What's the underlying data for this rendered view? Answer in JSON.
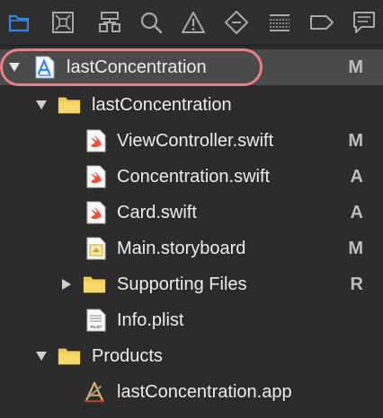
{
  "toolbar": {
    "buttons": [
      {
        "name": "project-navigator-button",
        "icon": "folder-icon",
        "active": true
      },
      {
        "name": "source-control-navigator-button",
        "icon": "source-control-icon"
      },
      {
        "name": "symbol-navigator-button",
        "icon": "hierarchy-icon"
      },
      {
        "name": "find-navigator-button",
        "icon": "search-icon"
      },
      {
        "name": "issue-navigator-button",
        "icon": "warning-icon"
      },
      {
        "name": "test-navigator-button",
        "icon": "diamond-icon"
      },
      {
        "name": "debug-navigator-button",
        "icon": "list-icon"
      },
      {
        "name": "breakpoint-navigator-button",
        "icon": "tag-icon"
      },
      {
        "name": "report-navigator-button",
        "icon": "message-icon"
      }
    ]
  },
  "tree": {
    "root": {
      "label": "lastConcentration",
      "status": "M",
      "icon": "xcode-project-icon",
      "expanded": true
    },
    "group": {
      "label": "lastConcentration",
      "icon": "folder-icon",
      "expanded": true
    },
    "files": [
      {
        "label": "ViewController.swift",
        "status": "M",
        "icon": "swift-file-icon"
      },
      {
        "label": "Concentration.swift",
        "status": "A",
        "icon": "swift-file-icon"
      },
      {
        "label": "Card.swift",
        "status": "A",
        "icon": "swift-file-icon"
      },
      {
        "label": "Main.storyboard",
        "status": "M",
        "icon": "storyboard-file-icon"
      }
    ],
    "supporting": {
      "label": "Supporting Files",
      "status": "R",
      "icon": "folder-icon",
      "expanded": false
    },
    "plist": {
      "label": "Info.plist",
      "icon": "plist-file-icon",
      "badge": "PLIST"
    },
    "products": {
      "label": "Products",
      "icon": "folder-icon",
      "expanded": true
    },
    "app": {
      "label": "lastConcentration.app",
      "icon": "app-product-icon"
    }
  },
  "colors": {
    "accent": "#2f86e8",
    "folder": "#f2c94c",
    "swift": "#f05138",
    "highlight": "#e87f86"
  }
}
